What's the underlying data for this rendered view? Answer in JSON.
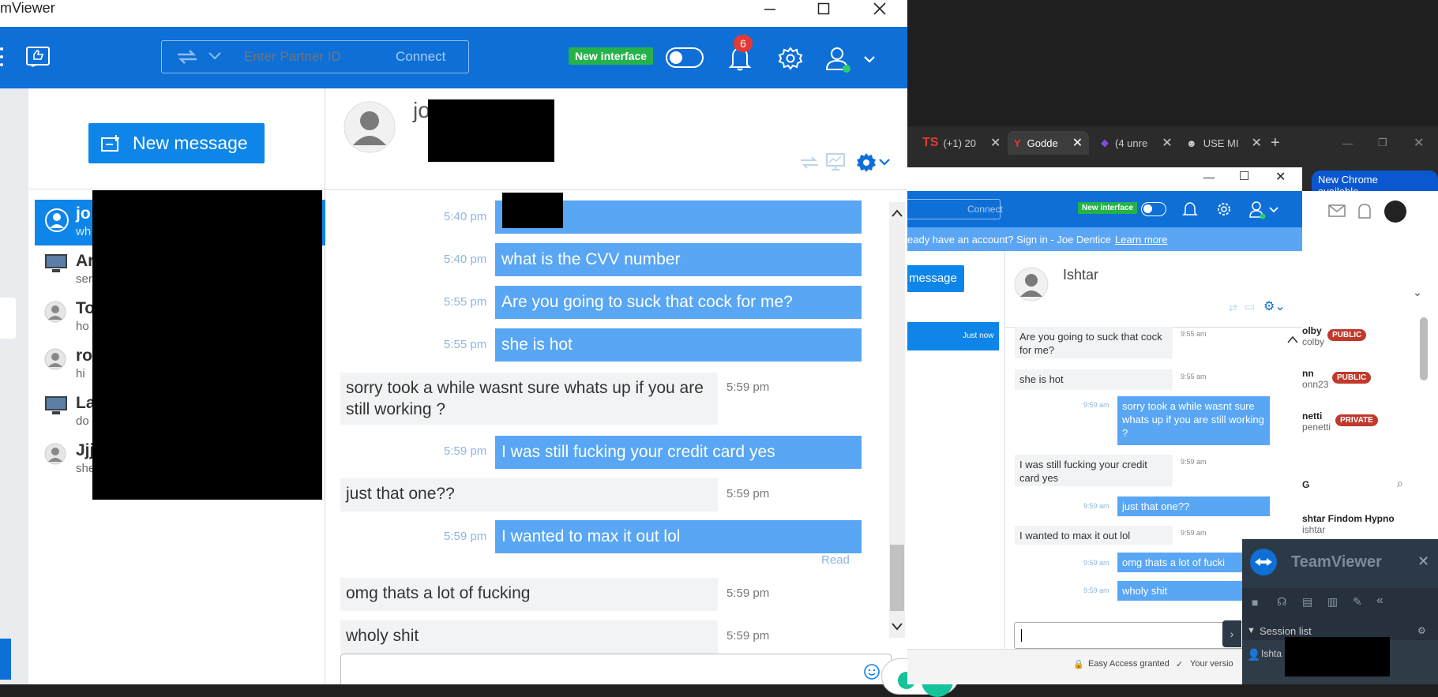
{
  "window": {
    "title": "mViewer"
  },
  "toolbar": {
    "partner_placeholder": "Enter Partner ID",
    "connect_label": "Connect",
    "new_interface_label": "New interface",
    "notification_count": "6"
  },
  "left": {
    "new_message_label": "New message",
    "contacts": [
      {
        "name": "jo",
        "sub": "wh",
        "selected": true,
        "icon": "user-icon"
      },
      {
        "name": "Ar",
        "sub": "ser",
        "icon": "computer-icon"
      },
      {
        "name": "To",
        "sub": "ho",
        "icon": "user-icon"
      },
      {
        "name": "ro",
        "sub": "hi",
        "icon": "user-icon"
      },
      {
        "name": "La",
        "sub": "do",
        "icon": "computer-icon"
      },
      {
        "name": "Jjj",
        "sub": "she",
        "icon": "user-icon"
      }
    ]
  },
  "chat": {
    "contact_name": "jo",
    "messages": [
      {
        "side": "right",
        "time": "5:40 pm",
        "text": ""
      },
      {
        "side": "right",
        "time": "5:40 pm",
        "text": "what is the CVV number"
      },
      {
        "side": "right",
        "time": "5:55 pm",
        "text": "Are you going to suck that cock for me?"
      },
      {
        "side": "right",
        "time": "5:55 pm",
        "text": "she is hot"
      },
      {
        "side": "left",
        "time": "5:59 pm",
        "text": "sorry took a while   wasnt sure whats up   if you are still working ?"
      },
      {
        "side": "right",
        "time": "5:59 pm",
        "text": "I was still fucking your credit card yes"
      },
      {
        "side": "left",
        "time": "5:59 pm",
        "text": "just that one??"
      },
      {
        "side": "right",
        "time": "5:59 pm",
        "text": "I wanted to max it out lol"
      },
      {
        "side": "left",
        "time": "5:59 pm",
        "text": "omg   thats a lot of fucking"
      },
      {
        "side": "left",
        "time": "5:59 pm",
        "text": "wholy shit"
      }
    ],
    "read_label": "Read"
  },
  "chrome": {
    "tabs": [
      "(+1) 20",
      "Godde",
      "(4 unre",
      "USE MI"
    ],
    "new_chrome_label": "New Chrome available"
  },
  "second": {
    "connect_label": "Connect",
    "new_interface_label": "New interface",
    "banner": "eady have an account? Sign in - Joe Dentice",
    "learn_more": "Learn more",
    "new_message_label": "message",
    "just_now": "Just now",
    "contact_name": "Ishtar",
    "messages": [
      {
        "side": "left",
        "time": "9:55 am",
        "text": "Are you going to suck that cock for me?"
      },
      {
        "side": "left",
        "time": "9:55 am",
        "text": "she is hot"
      },
      {
        "side": "right",
        "time": "9:59 am",
        "text": "sorry took a while   wasnt sure whats up   if you are still working ?"
      },
      {
        "side": "left",
        "time": "9:59 am",
        "text": "I was still fucking your credit card yes"
      },
      {
        "side": "right",
        "time": "9:59 am",
        "text": "just that one??"
      },
      {
        "side": "left",
        "time": "9:59 am",
        "text": "I wanted to max it out lol"
      },
      {
        "side": "right",
        "time": "9:59 am",
        "text": "omg   thats a lot of fucki"
      },
      {
        "side": "right",
        "time": "9:59 am",
        "text": "wholy shit"
      }
    ],
    "status_easy": "Easy Access granted",
    "status_version": "Your versio"
  },
  "bg_list": [
    {
      "name": "olby",
      "sub": "colby",
      "badge": "PUBLIC"
    },
    {
      "name": "nn",
      "sub": "onn23",
      "badge": "PUBLIC"
    },
    {
      "name": "netti",
      "sub": "penetti",
      "badge": "PRIVATE"
    }
  ],
  "bg_g": "G",
  "bg_entry": {
    "name": "shtar Findom Hypno",
    "sub": "ishtar"
  },
  "tv": {
    "title": "TeamViewer",
    "session_list": "Session list",
    "session_item": "Ishta"
  }
}
